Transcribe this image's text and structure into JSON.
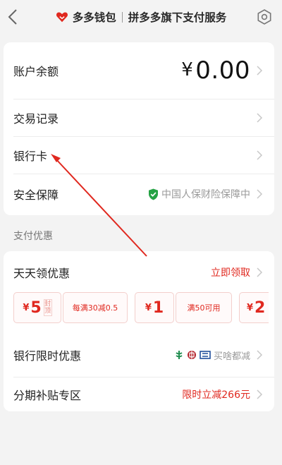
{
  "header": {
    "brand": "多多钱包",
    "subtitle": "拼多多旗下支付服务"
  },
  "account": {
    "balance_label": "账户余额",
    "currency": "¥",
    "balance_value": "0.00",
    "transactions_label": "交易记录",
    "bank_card_label": "银行卡",
    "security_label": "安全保障",
    "security_badge": "中国人保财险保障中"
  },
  "promotions": {
    "section_title": "支付优惠",
    "daily": {
      "label": "天天领优惠",
      "action": "立即领取",
      "coupons": [
        {
          "currency": "¥",
          "amount": "5",
          "tag": "封顶",
          "desc": "每满30减0.5"
        },
        {
          "currency": "¥",
          "amount": "1",
          "desc": "满50可用"
        },
        {
          "currency": "¥",
          "amount": "2"
        }
      ]
    },
    "bank_limited": {
      "label": "银行限时优惠",
      "note": "买啥都减"
    },
    "installment": {
      "label": "分期补贴专区",
      "note": "限时立减266元"
    }
  },
  "colors": {
    "accent_red": "#e0281f",
    "shield_green": "#25a244",
    "background": "#f3f3f3"
  }
}
